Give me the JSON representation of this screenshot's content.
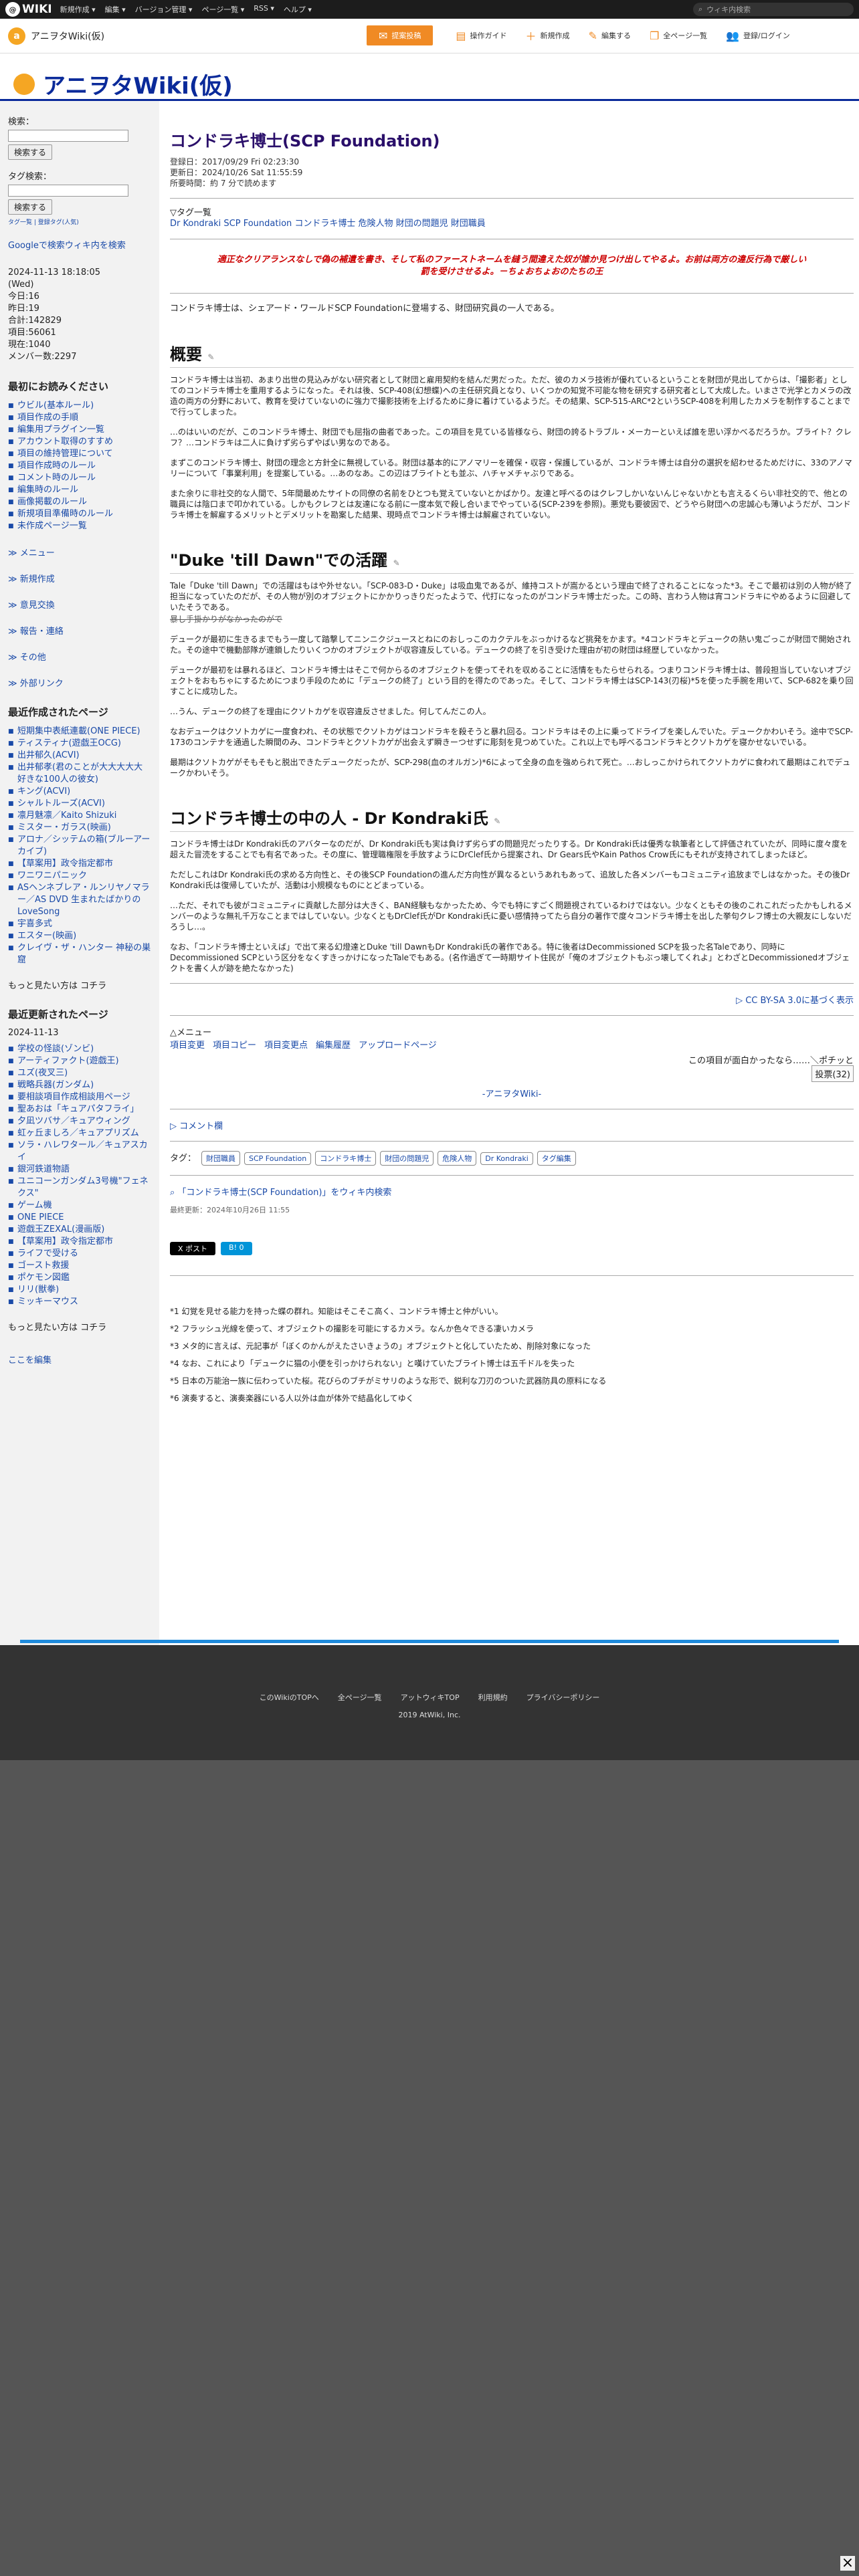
{
  "topbar": {
    "logo": "WIKI",
    "menu": [
      "新規作成 ▾",
      "編集 ▾",
      "バージョン管理 ▾",
      "ページ一覧 ▾",
      "RSS ▾",
      "ヘルプ ▾"
    ],
    "search_placeholder": "ウィキ内検索"
  },
  "subbar": {
    "site": "アニヲタWiki(仮)",
    "tools": [
      "提案投稿",
      "操作ガイド",
      "新規作成",
      "編集する",
      "全ページ一覧",
      "登録/ログイン"
    ]
  },
  "header": {
    "title": "アニヲタWiki(仮)"
  },
  "sidebar": {
    "search_label": "検索：",
    "search_btn": "検索する",
    "tag_label": "タグ検索：",
    "tag_btn": "検索する",
    "tag_links": "タグ一覧 | 登録タグ(人気)",
    "google": "Googleで検索ウィキ内を検索",
    "stats": [
      "2024-11-13 18:18:05",
      "(Wed)",
      "今日:16",
      "昨日:19",
      "合計:142829",
      "項目:56061",
      "現在:1040",
      "メンバー数:2297"
    ],
    "sec1_title": "最初にお読みください",
    "sec1_items": [
      "ウビル(基本ルール)",
      "項目作成の手順",
      "編集用プラグイン一覧",
      "アカウント取得のすすめ",
      "項目の維持管理について",
      "項目作成時のルール",
      "コメント時のルール",
      "編集時のルール",
      "画像掲載のルール",
      "新規項目準備時のルール",
      "未作成ページ一覧"
    ],
    "links": [
      "メニュー",
      "新規作成",
      "意見交換",
      "報告・連絡",
      "その他",
      "外部リンク"
    ],
    "sec2_title": "最近作成されたページ",
    "sec2_items": [
      "短期集中表紙連載(ONE PIECE)",
      "ティスティナ(遊戯王OCG)",
      "出井郁久(ACVI)",
      "出井郁孝(君のことが大大大大大好きな100人の彼女)",
      "キング(ACVI)",
      "シャルトルーズ(ACVI)",
      "凛月魅凛／Kaito Shizuki",
      "ミスター・ガラス(映画)",
      "アロナ／シッテムの箱(ブルーアーカイブ)",
      "【草案用】政令指定都市",
      "ワニワニパニック",
      "ASヘンネブレア・ルンリヤノマラー／AS DVD 生まれたばかりのLoveSong",
      "宇喜多式",
      "エスター(映画)",
      "クレイヴ・ザ・ハンター 神秘の巣窟"
    ],
    "sec3_title": "最近更新されたページ",
    "sec3_date": "2024-11-13",
    "sec3_items": [
      "学校の怪談(ゾンビ)",
      "アーティファクト(遊戯王)",
      "ユズ(夜叉三)",
      "戦略兵器(ガンダム)",
      "要相談項目作成相談用ページ",
      "聖あおは「キュアパタフライ」",
      "夕凪ツバサ／キュアウィング",
      "虹ヶ丘ましろ／キュアプリズム",
      "ソラ・ハレワタール／キュアスカイ",
      "銀河鉄道物語",
      "ユニコーンガンダム3号機\"フェネクス\"",
      "ゲーム機",
      "ONE PIECE",
      "遊戯王ZEXAL(漫画版)",
      "【草案用】政令指定都市",
      "ライフで受ける",
      "ゴースト救援",
      "ポケモン図鑑",
      "リリ(獣拳)",
      "ミッキーマウス"
    ],
    "more": "もっと見たい方は コチラ",
    "edit_here": "ここを編集"
  },
  "main": {
    "title": "コンドラキ博士(SCP Foundation)",
    "created": "登録日：2017/09/29 Fri 02:23:30",
    "updated": "更新日：2024/10/26 Sat 11:55:59",
    "readtime": "所要時間：約 7 分で読めます",
    "tag_head": "▽タグ一覧",
    "tags": "Dr Kondraki SCP Foundation コンドラキ博士 危険人物 財団の問題児 財団職員",
    "quote": "適正なクリアランスなしで偽の補遺を書き、そして私のファーストネームを縫う間違えた奴が誰か見つけ出してやるよ。お前は両方の違反行為で厳しい罰を受けさせるよ。－ちょおちょおのたちの王",
    "intro": "コンドラキ博士は、シェアード・ワールドSCP Foundationに登場する、財団研究員の一人である。",
    "h_summary": "概要",
    "p1": "コンドラキ博士は当初、あまり出世の見込みがない研究者として財団と雇用契約を結んだ男だった。ただ、彼のカメラ技術が優れているということを財団が見出してからは、「撮影者」としてのコンドラキ博士を重用するようになった。それは後、SCP-408(幻想蝶)への主任研究員となり、いくつかの知覚不可能な物を研究する研究者として大成した。いまさで光学とカメラの改造の両方の分野において、教育を受けていないのに強力で撮影技術を上げるために身に着けているようだ。その結果、SCP-515-ARC*2というSCP-408を利用したカメラを制作することまでで行ってしまった。",
    "p2": "…のはいいのだが、このコンドラキ博士、財団でも屈指の曲者であった。この項目を見ている皆様なら、財団の誇るトラブル・メーカーといえば誰を思い浮かべるだろうか。ブライト？クレフ？…コンドラキは二人に負けず劣らずやばい男なのである。",
    "p3": "まずこのコンドラキ博士、財団の理念と方針全に無視している。財団は基本的にアノマリーを確保・収容・保護しているが、コンドラキ博士は自分の選択を紹わせるためだけに、33のアノマリーについて「事業利用」を提案している。…あのなあ。この辺はブライトとも並ぶ、ハチャメチャぶりである。",
    "p4": "また余りに非社交的な人間で、5年間最めたサイトの同僚の名前をひとつも覚えていないとかばかり。友達と呼べるのはクレフしかいないんじゃないかとも言えるくらい非社交的で、他との職員には陰口まで叩かれている。しかもクレフとは友達になる前に一度本気で殺し合いまでやっている(SCP-239を参照)。悪党も要彼因で、どうやら財団への忠誠心も薄いようだが、コンドラキ博士を解雇するメリットとデメリットを勘案した結果、現時点でコンドラキ博士は解雇されていない。",
    "h_duke": "\"Duke 'till Dawn\"での活躍",
    "p5": "Tale「Duke 'till Dawn」での活躍はもはや外せない。「SCP-083-D・Duke」は吸血鬼であるが、維持コストが嵩かるという理由で終了されることになった*3。そこで最初は別の人物が終了担当になっていたのだが、その人物が別のオブジェクトにかかりっきりだったようで、代打になったのがコンドラキ博士だった。この時、言わう人物は宵コンドラキにやめるように回避していたそうである。",
    "p5s": "暴し手掛かりがなかったのがで",
    "p6": "デュークが最初に生きるまでもう一度して踏撃してニンニクジュースとねにのおしっこのカクテルをぶっかけるなど挑発をかます。*4コンドラキとデュークの熱い鬼ごっこが財団で開始された。その途中で機動部隊が連鎖したりいくつかのオブジェクトが収容違反している。デュークの終了を引き受けた理由が初の財団は経歴していなかった。",
    "p7": "デュークが最初をは暴れるほど、コンドラキ博士はそこで何からるのオブジェクトを使ってそれを収めることに活情をもたらせられる。つまりコンドラキ博士は、普段担当していないオブジェクトをおもちゃにするためにつまり手段のために「デュークの終了」という目的を得たのであった。そして、コンドラキ博士はSCP-143(刃桜)*5を使った手腕を用いて、SCP-682を乗り回すことに成功した。",
    "p8": "…うん、デュークの終了を理由にクソトカゲを収容違反させました。何してんだこの人。",
    "p9": "なおデュークはクソトカゲに一度食われ、その状態でクソトカゲはコンドラキを殺そうと暴れ回る。コンドラキはその上に乗ってドライブを楽しんでいた。デュークかわいそう。途中でSCP-173のコンテナを通過した瞬間のみ、コンドラキとクソトカゲが出会えず瞬きーつせずに彫刻を見つめていた。これ以上でも呼べるコンドラキとクソトカゲを寝かせないでいる。",
    "p10": "最期はクソトカゲがそもそもと脱出できたデュークだったが、SCP-298(血のオルガン)*6によって全身の血を強められて死亡。…おしっこかけられてクソトカゲに食われて最期はこれでデュークかわいそう。",
    "h_inner": "コンドラキ博士の中の人 - Dr Kondraki氏",
    "p11": "コンドラキ博士はDr Kondraki氏のアバターなのだが、Dr Kondraki氏も実は負けず劣らずの問題児だったりする。Dr Kondraki氏は優秀な執筆者として評価されていたが、同時に度々度を超えた冒涜をすることでも有名であった。その度に、管理職権限を手放すようにDrClef氏から提案され、Dr Gears氏やKain Pathos Crow氏にもそれが支持されてしまったほど。",
    "p12": "ただしこれはDr Kondraki氏の求める方向性と、その後SCP Foundationの進んだ方向性が異なるというあれもあって、追放した各メンバーもコミュニティ追放までしはなかった。その後Dr Kondraki氏は復帰していたが、活動は小規模なものにとどまっている。",
    "p13": "…ただ、それでも彼がコミュニティに貢献した部分は大きく、BAN経験もなかったため、今でも特にすごく問題視されているわけではない。少なくともその後のこれこれだったかもしれるメンバーのような無礼千万なことまではしていない。少なくともDrClef氏がDr Kondraki氏に憂い感情持ってたら自分の著作で度々コンドラキ博士を出した挙句クレフ博士の大親友にしないだろうし…。",
    "p14": "なお、「コンドラキ博士といえば」で出て来る幻燈達とDuke 'till DawnもDr Kondraki氏の著作である。特に後者はDecommissioned SCPを扱った名Taleであり、同時にDecommissioned SCPという区分をなくすきっかけになったTaleでもある。(名作過ぎて一時期サイト住民が「俺のオブジェクトもぶっ壊してくれよ」とわざとDecommissionedオブジェクトを書く人が跡を絶たなかった)",
    "license": "▷ CC BY-SA 3.0に基づく表示",
    "menu_head": "△メニュー",
    "row_links": [
      "項目変更",
      "項目コピー",
      "項目変更点",
      "編集履歴",
      "アップロードページ"
    ],
    "vote_text": "この項目が面白かったなら……＼ポチッと",
    "vote_btn": "投票(32)",
    "site_footer": "-アニヲタWiki-",
    "comment_head": "▷ コメント欄",
    "tag_label": "タグ：",
    "tag_btns": [
      "財団職員",
      "SCP Foundation",
      "コンドラキ博士",
      "財団の問題児",
      "危険人物",
      "Dr Kondraki",
      "タグ編集"
    ],
    "search_wiki": "「コンドラキ博士(SCP Foundation)」をウィキ内検索",
    "last_updated": "最終更新：2024年10月26日 11:55",
    "share": [
      "X ポスト",
      "B! 0"
    ],
    "footnotes": [
      "*1 幻覚を見せる能力を持った蝶の群れ。知能はそこそこ高く、コンドラキ博士と仲がいい。",
      "*2 フラッシュ光線を使って、オブジェクトの撮影を可能にするカメラ。なんか色々できる凄いカメラ",
      "*3 メタ的に言えば、元記事が「ぼくのかんがえたさいきょうの」オブジェクトと化していたため、削除対象になった",
      "*4 なお、これにより「デュークに猫の小便を引っかけられない」と嘆けていたブライト博士は五千ドルを失った",
      "*5 日本の万能治一族に伝わっていた桜。花びらのブチがミサリのような形で、鋭利な刀刃のついた武器防具の原料になる",
      "*6 演奏すると、演奏楽器にいる人以外は血が体外で結晶化してゆく"
    ]
  },
  "footer": {
    "links": [
      "このWikiのTOPへ",
      "全ページ一覧",
      "アットウィキTOP",
      "利用規約",
      "プライバシーポリシー"
    ],
    "copy": "2019 AtWiki, Inc."
  }
}
